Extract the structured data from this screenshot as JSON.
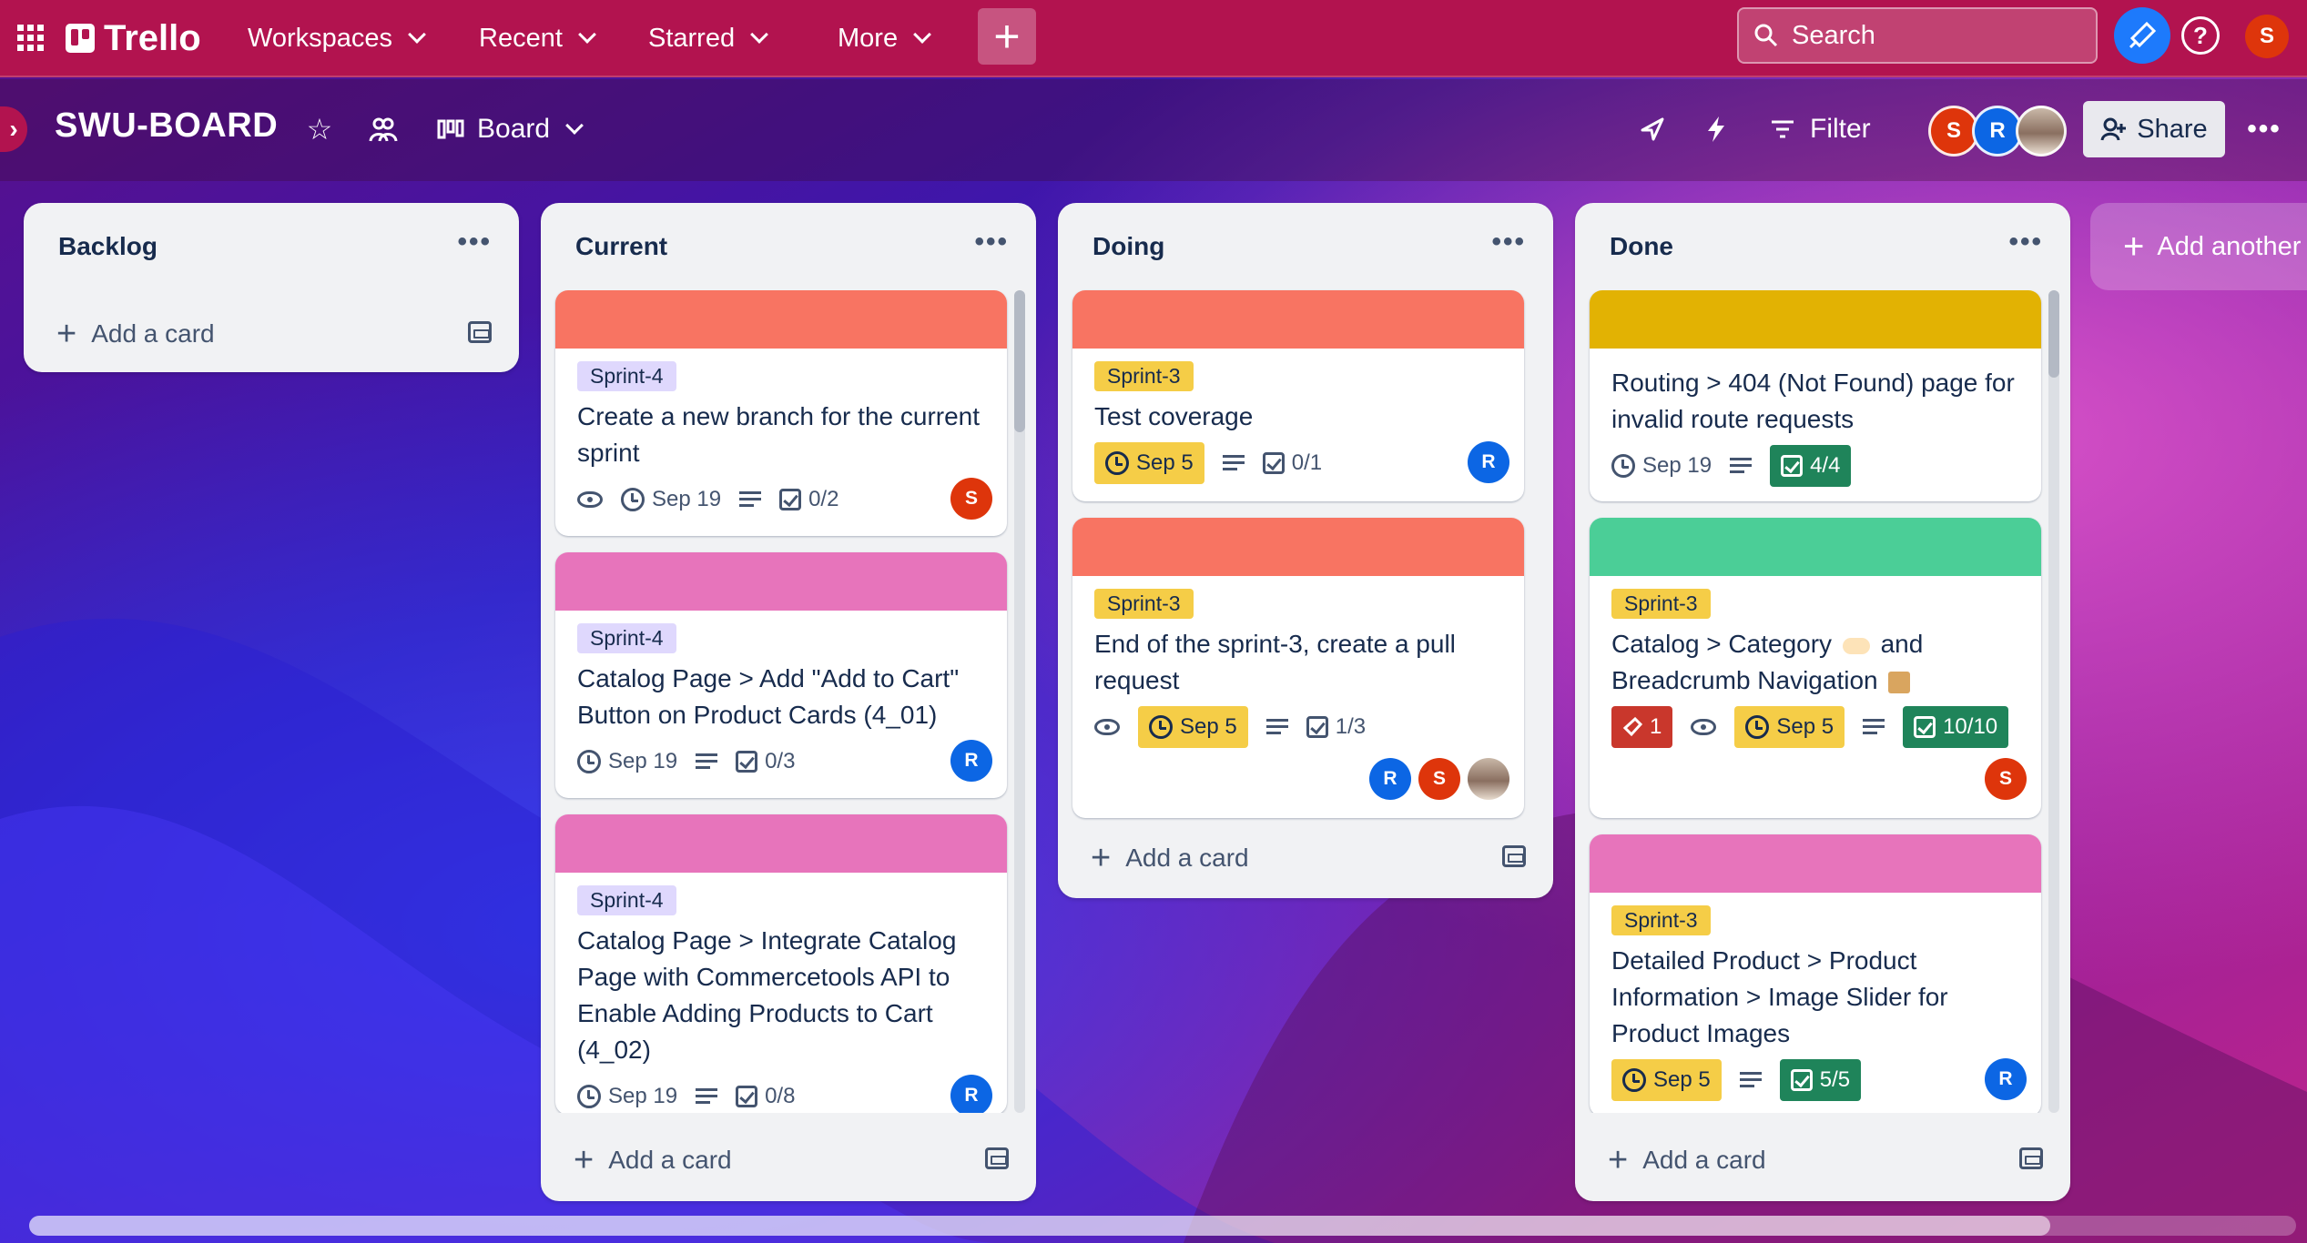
{
  "header": {
    "app_name": "Trello",
    "nav": [
      "Workspaces",
      "Recent",
      "Starred",
      "More"
    ],
    "create_label": "+",
    "search_placeholder": "Search",
    "help_label": "?",
    "user_initial": "S"
  },
  "board": {
    "title": "SWU-BOARD",
    "view_label": "Board",
    "filter_label": "Filter",
    "share_label": "Share",
    "members": [
      "S",
      "R"
    ]
  },
  "lists": [
    {
      "title": "Backlog",
      "add_label": "Add a card"
    },
    {
      "title": "Current",
      "add_label": "Add a card"
    },
    {
      "title": "Doing",
      "add_label": "Add a card"
    },
    {
      "title": "Done",
      "add_label": "Add a card"
    }
  ],
  "add_list_label": "Add another",
  "cards": {
    "c1": {
      "cover_color": "#f87462",
      "label": "Sprint-4",
      "title": "Create a new branch for the current sprint",
      "due": "Sep 19",
      "checklist": "0/2",
      "members": [
        "S"
      ]
    },
    "c2": {
      "cover_color": "#e774bb",
      "label": "Sprint-4",
      "title": "Catalog Page > Add \"Add to Cart\" Button on Product Cards (4_01)",
      "due": "Sep 19",
      "checklist": "0/3",
      "members": [
        "R"
      ]
    },
    "c3": {
      "cover_color": "#e774bb",
      "label": "Sprint-4",
      "title": "Catalog Page > Integrate Catalog Page with Commercetools API to Enable Adding Products to Cart (4_02)",
      "due": "Sep 19",
      "checklist": "0/8",
      "members": [
        "R"
      ]
    },
    "d1": {
      "cover_color": "#f87462",
      "label": "Sprint-3",
      "title": "Test coverage",
      "due": "Sep 5",
      "checklist": "0/1",
      "members": [
        "R"
      ]
    },
    "d2": {
      "cover_color": "#f87462",
      "label": "Sprint-3",
      "title": "End of the sprint-3, create a pull request",
      "due": "Sep 5",
      "checklist": "1/3",
      "members": [
        "R",
        "S"
      ]
    },
    "n1": {
      "cover_color": "#e2b203",
      "title": "Routing > 404 (Not Found) page for invalid route requests",
      "due": "Sep 19",
      "checklist": "4/4"
    },
    "n2": {
      "cover_color": "#4bce97",
      "label": "Sprint-3",
      "title_line1": "Catalog > Category",
      "title_line1_end": "and",
      "title_line2": "Breadcrumb Navigation",
      "votes": "1",
      "due": "Sep 5",
      "checklist": "10/10",
      "members": [
        "S"
      ]
    },
    "n3": {
      "cover_color": "#e774bb",
      "label": "Sprint-3",
      "title": "Detailed Product > Product Information > Image Slider for Product Images",
      "due": "Sep 5",
      "checklist": "5/5",
      "members": [
        "R"
      ]
    }
  },
  "colors": {
    "topbar": "#b2134f",
    "avatar_s": "#de350b",
    "avatar_r": "#0c66e4",
    "complete": "#1f845a",
    "due_soon": "#f5cd47"
  }
}
